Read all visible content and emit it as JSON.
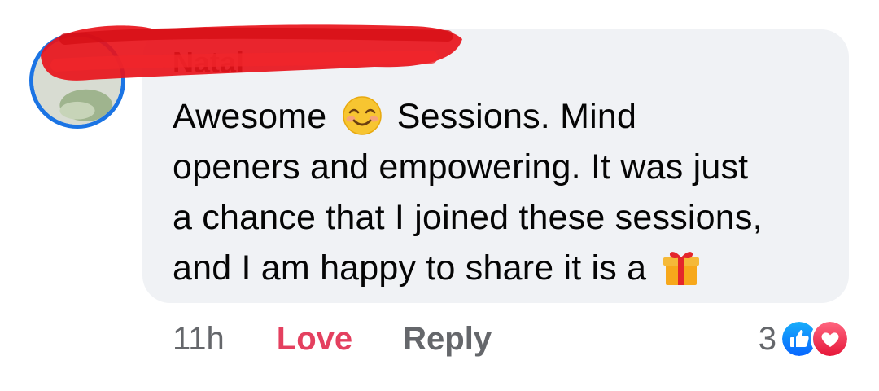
{
  "comment": {
    "author": "Natal",
    "text_line1_a": "Awesome",
    "emoji1": "smiling-face-icon",
    "text_line1_b": "Sessions. Mind",
    "text_line2": "openers and empowering. It was just",
    "text_line3": "a chance that I joined these sessions,",
    "text_line4": "and I am happy to share it is a",
    "emoji2": "gift-icon"
  },
  "actions": {
    "time": "11h",
    "love_label": "Love",
    "reply_label": "Reply"
  },
  "reactions": {
    "count": "3",
    "types": [
      "like",
      "love"
    ]
  },
  "colors": {
    "bubble": "#f0f2f5",
    "love": "#e4405f",
    "like": "#1b74e4",
    "muted": "#65676b",
    "redaction": "#e8141b"
  }
}
